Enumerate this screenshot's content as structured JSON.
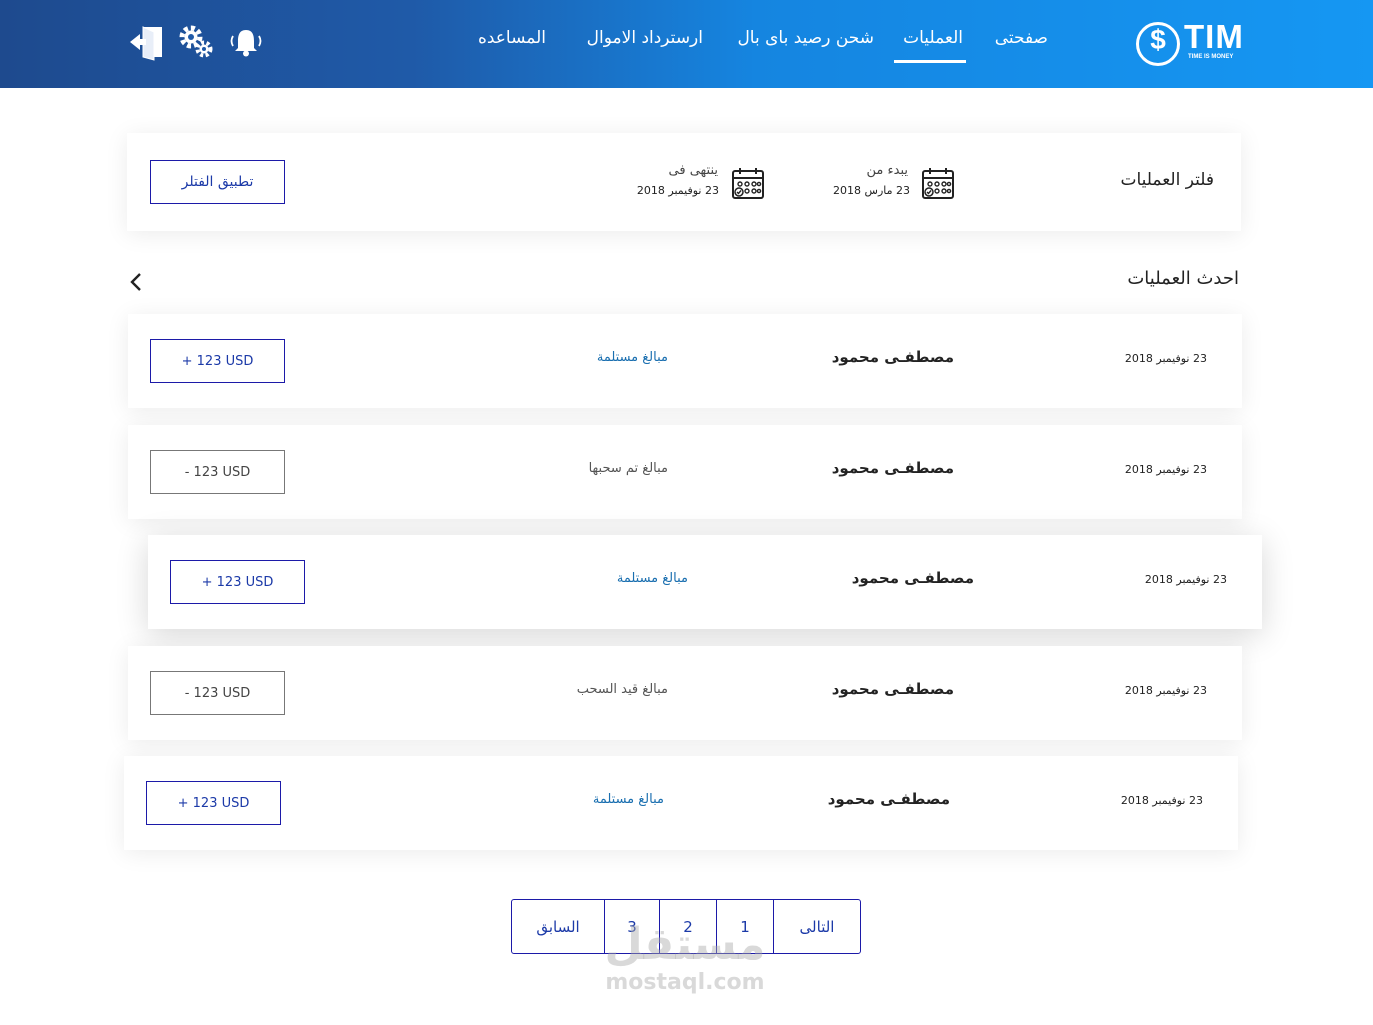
{
  "header": {
    "logo_word": "TIM",
    "logo_tagline": "TIME IS MONEY",
    "nav": [
      "صفحتى",
      "العمليات",
      "شحن رصيد باى بال",
      "ارسترداد الاموال",
      "المساعده"
    ],
    "active_nav": "العمليات"
  },
  "filter": {
    "title": "فلتر العمليات",
    "from_label": "يبدء من",
    "from_date": "23 مارس 2018",
    "to_label": "ينتهى فى",
    "to_date": "23 نوفيمبر 2018",
    "apply_label": "تطبيق الفتلر"
  },
  "latest": {
    "title": "احدث العمليات"
  },
  "transactions": [
    {
      "date": "23 نوفيمبر 2018",
      "name": "مصطفـى محمود",
      "type": "مبالغ مستلمة",
      "amount": "+ 123 USD",
      "sign": "positive"
    },
    {
      "date": "23 نوفيمبر 2018",
      "name": "مصطفـى محمود",
      "type": "مبالغ تم سحبها",
      "amount": "- 123 USD",
      "sign": "negative"
    },
    {
      "date": "23 نوفيمبر 2018",
      "name": "مصطفـى محمود",
      "type": "مبالغ مستلمة",
      "amount": "+ 123 USD",
      "sign": "positive"
    },
    {
      "date": "23 نوفيمبر 2018",
      "name": "مصطفـى محمود",
      "type": "مبالغ قيد السحب",
      "amount": "- 123 USD",
      "sign": "negative"
    },
    {
      "date": "23 نوفيمبر 2018",
      "name": "مصطفـى محمود",
      "type": "مبالغ مستلمة",
      "amount": "+ 123 USD",
      "sign": "positive"
    }
  ],
  "pagination": {
    "prev": "السابق",
    "pages": [
      "3",
      "2",
      "1"
    ],
    "next": "التالى"
  },
  "watermark": {
    "arabic": "مستقل",
    "latin": "mostaql.com"
  },
  "colors": {
    "accent": "#1c1aa8",
    "link_positive": "#1a6fb0",
    "text_negative": "#555555"
  }
}
